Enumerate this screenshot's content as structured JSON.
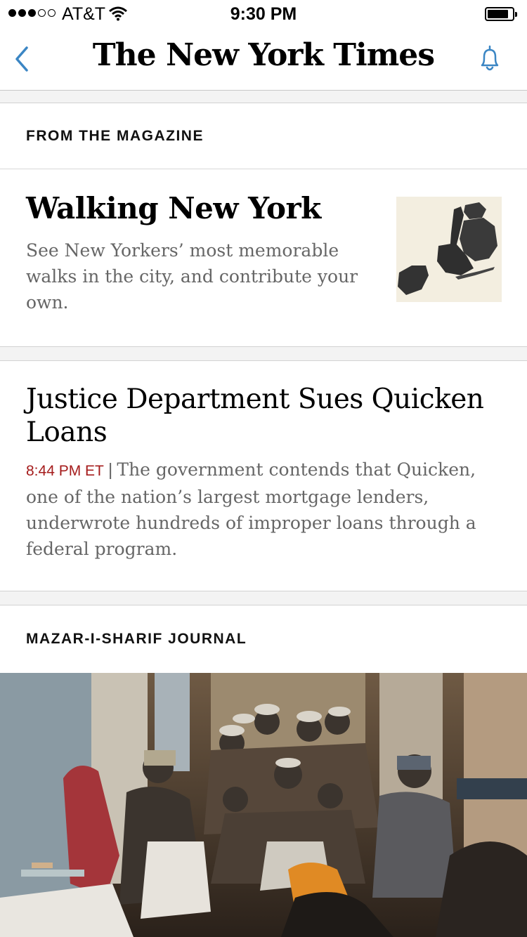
{
  "status_bar": {
    "carrier": "AT&T",
    "time": "9:30 PM",
    "signal_bars_filled": 3,
    "signal_bars_total": 5
  },
  "nav": {
    "logo": "The New York Times",
    "back_icon": "chevron-left-icon",
    "bell_icon": "bell-icon"
  },
  "sections": {
    "magazine": {
      "label": "FROM THE MAGAZINE",
      "headline": "Walking New York",
      "summary": "See New Yorkers’ most memorable walks in the city, and contribute your own."
    },
    "story": {
      "headline": "Justice Department Sues Quicken Loans",
      "timestamp": "8:44 PM ET",
      "separator": "|",
      "summary": "The government contends that Quicken, one of the nation’s largest mortgage lenders, underwrote hundreds of improper loans through a federal program."
    },
    "journal": {
      "label": "MAZAR-I-SHARIF JOURNAL"
    }
  },
  "colors": {
    "accent_blue": "#3b86c4",
    "timestamp_red": "#a51c1c",
    "summary_gray": "#666666"
  }
}
